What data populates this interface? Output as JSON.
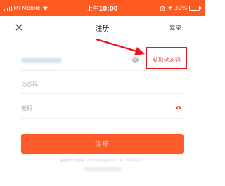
{
  "status_bar": {
    "carrier": "Mi Mobile",
    "time": "上午10:00",
    "battery": "39%",
    "battery_level": 0.39,
    "icons": [
      "signal-icon",
      "wifi-icon",
      "alarm-icon",
      "location-icon",
      "battery-icon"
    ]
  },
  "nav": {
    "close_icon": "close-icon",
    "title": "注册",
    "login_label": "登录"
  },
  "form": {
    "phone_clear_icon": "clear-icon",
    "get_code_label": "获取动态码",
    "code_placeholder": "动态码",
    "password_placeholder": "密码",
    "password_toggle_icon": "eye-icon"
  },
  "register_button_label": "注册",
  "colors": {
    "status_bar": "#ff5a1f",
    "button": "#ff5a2a",
    "accent": "#e8483a",
    "annotation": "#e8161c"
  }
}
